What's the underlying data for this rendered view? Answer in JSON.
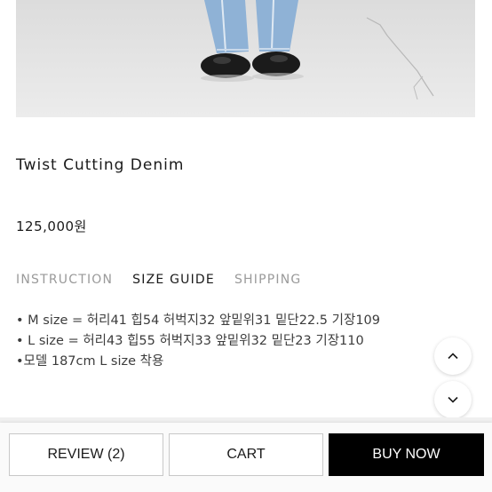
{
  "product": {
    "name": "Twist Cutting Denim",
    "price": "125,000원"
  },
  "tabs": [
    {
      "label": "INSTRUCTION",
      "active": false
    },
    {
      "label": "SIZE GUIDE",
      "active": true
    },
    {
      "label": "SHIPPING",
      "active": false
    }
  ],
  "size_guide": [
    "• M size = 허리41 힙54 허벅지32 앞밑위31 밑단22.5 기장109",
    "• L size = 허리43 힙55 허벅지33 앞밑위32 밑단23 기장110",
    "•모델 187cm L size 착용"
  ],
  "scroll": {
    "up_icon": "chevron-up-icon",
    "down_icon": "chevron-down-icon"
  },
  "actions": {
    "review": "REVIEW (2)",
    "cart": "CART",
    "buy_now": "BUY NOW"
  },
  "colors": {
    "primary": "#000000",
    "tab_inactive": "#9a9a9a",
    "text": "#1a1a1a"
  }
}
